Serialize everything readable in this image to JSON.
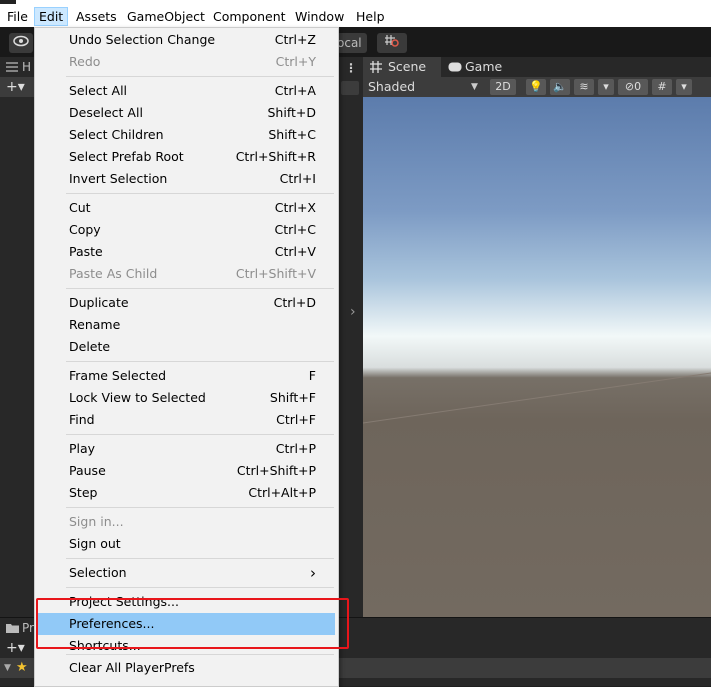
{
  "menubar": {
    "items": [
      "File",
      "Edit",
      "Assets",
      "GameObject",
      "Component",
      "Window",
      "Help"
    ],
    "active_index": 1
  },
  "toolbar": {
    "local_label": "ocal"
  },
  "left_panel": {
    "header": "H",
    "add": "+▾"
  },
  "scene": {
    "tabs": [
      "Scene",
      "Game"
    ],
    "shading": "Shaded",
    "mode_2d": "2D",
    "hidden_count": "0"
  },
  "bottom_panel": {
    "header": "Pr",
    "add": "+▾"
  },
  "edit_menu": {
    "items": [
      {
        "label": "Undo Selection Change",
        "shortcut": "Ctrl+Z",
        "disabled": false
      },
      {
        "label": "Redo",
        "shortcut": "Ctrl+Y",
        "disabled": true
      },
      {
        "label": "Select All",
        "shortcut": "Ctrl+A",
        "disabled": false
      },
      {
        "label": "Deselect All",
        "shortcut": "Shift+D",
        "disabled": false
      },
      {
        "label": "Select Children",
        "shortcut": "Shift+C",
        "disabled": false
      },
      {
        "label": "Select Prefab Root",
        "shortcut": "Ctrl+Shift+R",
        "disabled": false
      },
      {
        "label": "Invert Selection",
        "shortcut": "Ctrl+I",
        "disabled": false
      },
      {
        "label": "Cut",
        "shortcut": "Ctrl+X",
        "disabled": false
      },
      {
        "label": "Copy",
        "shortcut": "Ctrl+C",
        "disabled": false
      },
      {
        "label": "Paste",
        "shortcut": "Ctrl+V",
        "disabled": false
      },
      {
        "label": "Paste As Child",
        "shortcut": "Ctrl+Shift+V",
        "disabled": true
      },
      {
        "label": "Duplicate",
        "shortcut": "Ctrl+D",
        "disabled": false
      },
      {
        "label": "Rename",
        "shortcut": "",
        "disabled": false
      },
      {
        "label": "Delete",
        "shortcut": "",
        "disabled": false
      },
      {
        "label": "Frame Selected",
        "shortcut": "F",
        "disabled": false
      },
      {
        "label": "Lock View to Selected",
        "shortcut": "Shift+F",
        "disabled": false
      },
      {
        "label": "Find",
        "shortcut": "Ctrl+F",
        "disabled": false
      },
      {
        "label": "Play",
        "shortcut": "Ctrl+P",
        "disabled": false
      },
      {
        "label": "Pause",
        "shortcut": "Ctrl+Shift+P",
        "disabled": false
      },
      {
        "label": "Step",
        "shortcut": "Ctrl+Alt+P",
        "disabled": false
      },
      {
        "label": "Sign in...",
        "shortcut": "",
        "disabled": true
      },
      {
        "label": "Sign out",
        "shortcut": "",
        "disabled": false
      },
      {
        "label": "Selection",
        "shortcut": "›",
        "disabled": false
      },
      {
        "label": "Project Settings...",
        "shortcut": "",
        "disabled": false
      },
      {
        "label": "Preferences...",
        "shortcut": "",
        "disabled": false,
        "highlighted": true
      },
      {
        "label": "Shortcuts...",
        "shortcut": "",
        "disabled": false
      },
      {
        "label": "Clear All PlayerPrefs",
        "shortcut": "",
        "disabled": false
      }
    ]
  },
  "colors": {
    "highlight": "#91c9f7",
    "annotation_box": "#e8161b"
  }
}
